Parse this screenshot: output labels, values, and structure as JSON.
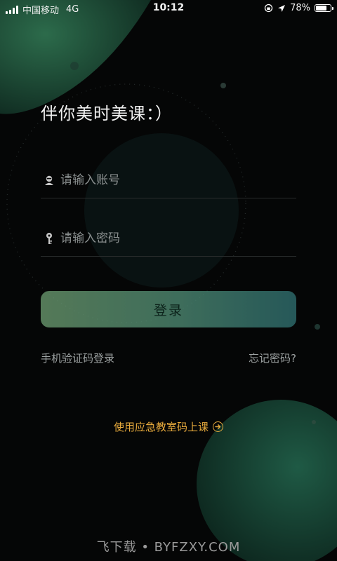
{
  "status_bar": {
    "carrier": "中国移动",
    "network": "4G",
    "time": "10:12",
    "battery": "78%",
    "battery_level": 0.78
  },
  "greeting": "伴你美时美课：）",
  "form": {
    "username_placeholder": "请输入账号",
    "password_placeholder": "请输入密码",
    "login_label": "登录"
  },
  "links": {
    "sms_login": "手机验证码登录",
    "forgot_password": "忘记密码?"
  },
  "emergency_link": "使用应急教室码上课",
  "watermark": "飞下载 • BYFZXY.COM",
  "colors": {
    "accent": "#e6a93c",
    "button_start": "#6b9a6f",
    "button_end": "#2f6f70",
    "background": "#050606"
  },
  "icons": {
    "username": "user-icon",
    "password": "key-icon",
    "emergency": "arrow-right-circle-icon"
  }
}
